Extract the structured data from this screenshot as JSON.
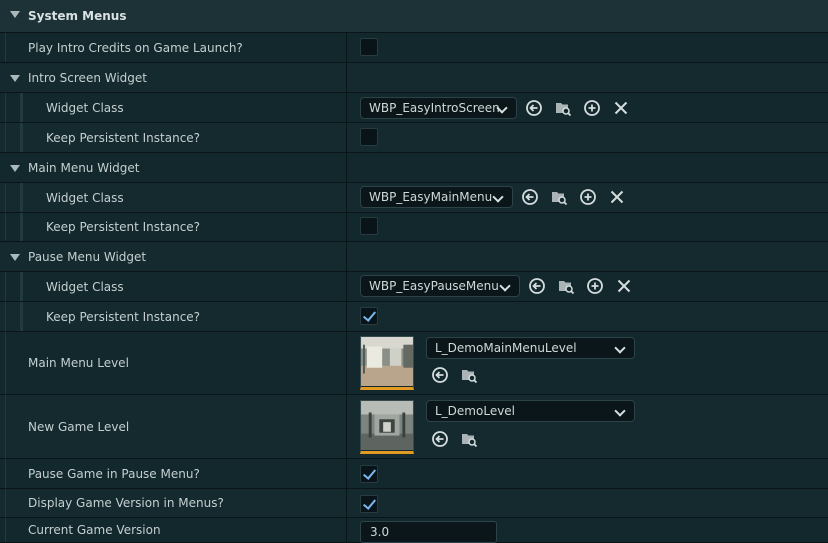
{
  "section": {
    "title": "System Menus"
  },
  "rows": {
    "play_intro": {
      "label": "Play Intro Credits on Game Launch?",
      "checked": false
    },
    "intro_widget": {
      "label": "Intro Screen Widget",
      "widget_class_label": "Widget Class",
      "widget_class_value": "WBP_EasyIntroScreen",
      "persistent_label": "Keep Persistent Instance?",
      "persistent_checked": false
    },
    "main_widget": {
      "label": "Main Menu Widget",
      "widget_class_label": "Widget Class",
      "widget_class_value": "WBP_EasyMainMenu",
      "persistent_label": "Keep Persistent Instance?",
      "persistent_checked": false
    },
    "pause_widget": {
      "label": "Pause Menu Widget",
      "widget_class_label": "Widget Class",
      "widget_class_value": "WBP_EasyPauseMenu",
      "persistent_label": "Keep Persistent Instance?",
      "persistent_checked": true
    },
    "main_menu_level": {
      "label": "Main Menu Level",
      "value": "L_DemoMainMenuLevel"
    },
    "new_game_level": {
      "label": "New Game Level",
      "value": "L_DemoLevel"
    },
    "pause_game": {
      "label": "Pause Game in Pause Menu?",
      "checked": true
    },
    "display_version": {
      "label": "Display Game Version in Menus?",
      "checked": true
    },
    "current_version": {
      "label": "Current Game Version",
      "value": "3.0"
    }
  },
  "icons": {
    "browse": "use-selected-arrow-icon",
    "find": "browse-folder-icon",
    "add": "add-circle-icon",
    "clear": "clear-x-icon"
  },
  "colors": {
    "checkmark": "#7ab8f0",
    "thumb_accent": "#e39a22",
    "background": "#13282c"
  }
}
